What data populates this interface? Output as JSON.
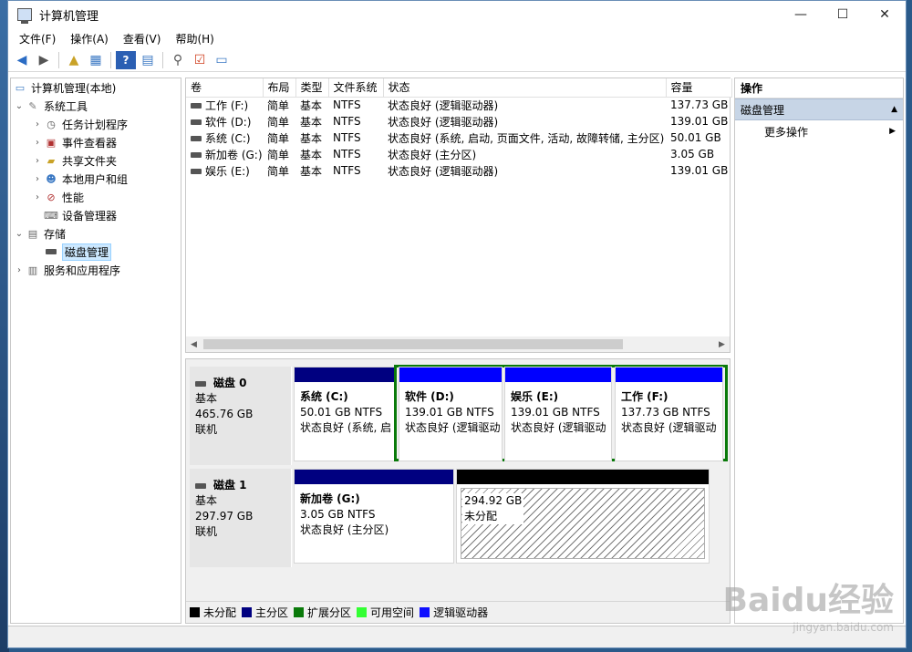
{
  "window": {
    "title": "计算机管理",
    "minimize": "—",
    "maximize": "☐",
    "close": "✕"
  },
  "menu": [
    "文件(F)",
    "操作(A)",
    "查看(V)",
    "帮助(H)"
  ],
  "tree": {
    "root": "计算机管理(本地)",
    "system_tools": "系统工具",
    "task_scheduler": "任务计划程序",
    "event_viewer": "事件查看器",
    "shared_folders": "共享文件夹",
    "local_users": "本地用户和组",
    "performance": "性能",
    "device_manager": "设备管理器",
    "storage": "存储",
    "disk_management": "磁盘管理",
    "services": "服务和应用程序"
  },
  "volume_table": {
    "headers": [
      "卷",
      "布局",
      "类型",
      "文件系统",
      "状态",
      "容量"
    ],
    "rows": [
      [
        "工作 (F:)",
        "简单",
        "基本",
        "NTFS",
        "状态良好 (逻辑驱动器)",
        "137.73 GB"
      ],
      [
        "软件 (D:)",
        "简单",
        "基本",
        "NTFS",
        "状态良好 (逻辑驱动器)",
        "139.01 GB"
      ],
      [
        "系统 (C:)",
        "简单",
        "基本",
        "NTFS",
        "状态良好 (系统, 启动, 页面文件, 活动, 故障转储, 主分区)",
        "50.01 GB"
      ],
      [
        "新加卷 (G:)",
        "简单",
        "基本",
        "NTFS",
        "状态良好 (主分区)",
        "3.05 GB"
      ],
      [
        "娱乐 (E:)",
        "简单",
        "基本",
        "NTFS",
        "状态良好 (逻辑驱动器)",
        "139.01 GB"
      ]
    ]
  },
  "disks": [
    {
      "name": "磁盘 0",
      "type": "基本",
      "size": "465.76 GB",
      "state": "联机",
      "partitions": [
        {
          "name": "系统  (C:)",
          "size": "50.01 GB NTFS",
          "status": "状态良好 (系统, 启"
        },
        {
          "name": "软件  (D:)",
          "size": "139.01 GB NTFS",
          "status": "状态良好 (逻辑驱动"
        },
        {
          "name": "娱乐  (E:)",
          "size": "139.01 GB NTFS",
          "status": "状态良好 (逻辑驱动"
        },
        {
          "name": "工作  (F:)",
          "size": "137.73 GB NTFS",
          "status": "状态良好 (逻辑驱动"
        }
      ]
    },
    {
      "name": "磁盘 1",
      "type": "基本",
      "size": "297.97 GB",
      "state": "联机",
      "partitions": [
        {
          "name": "新加卷  (G:)",
          "size": "3.05 GB NTFS",
          "status": "状态良好 (主分区)"
        },
        {
          "name": "",
          "size": "294.92 GB",
          "status": "未分配"
        }
      ]
    }
  ],
  "legend": [
    {
      "label": "未分配",
      "color": "#000000"
    },
    {
      "label": "主分区",
      "color": "#000080"
    },
    {
      "label": "扩展分区",
      "color": "#0a7a0a"
    },
    {
      "label": "可用空间",
      "color": "#33ff33"
    },
    {
      "label": "逻辑驱动器",
      "color": "#1010ff"
    }
  ],
  "actions": {
    "header": "操作",
    "section": "磁盘管理",
    "more": "更多操作"
  },
  "colors": {
    "primary": "#000080",
    "logical": "#0000ff",
    "extended": "#0a7a0a",
    "unallocated": "#000000",
    "selection": "#cce8ff"
  },
  "watermark": {
    "text": "Baidu经验",
    "sub": "jingyan.baidu.com"
  }
}
